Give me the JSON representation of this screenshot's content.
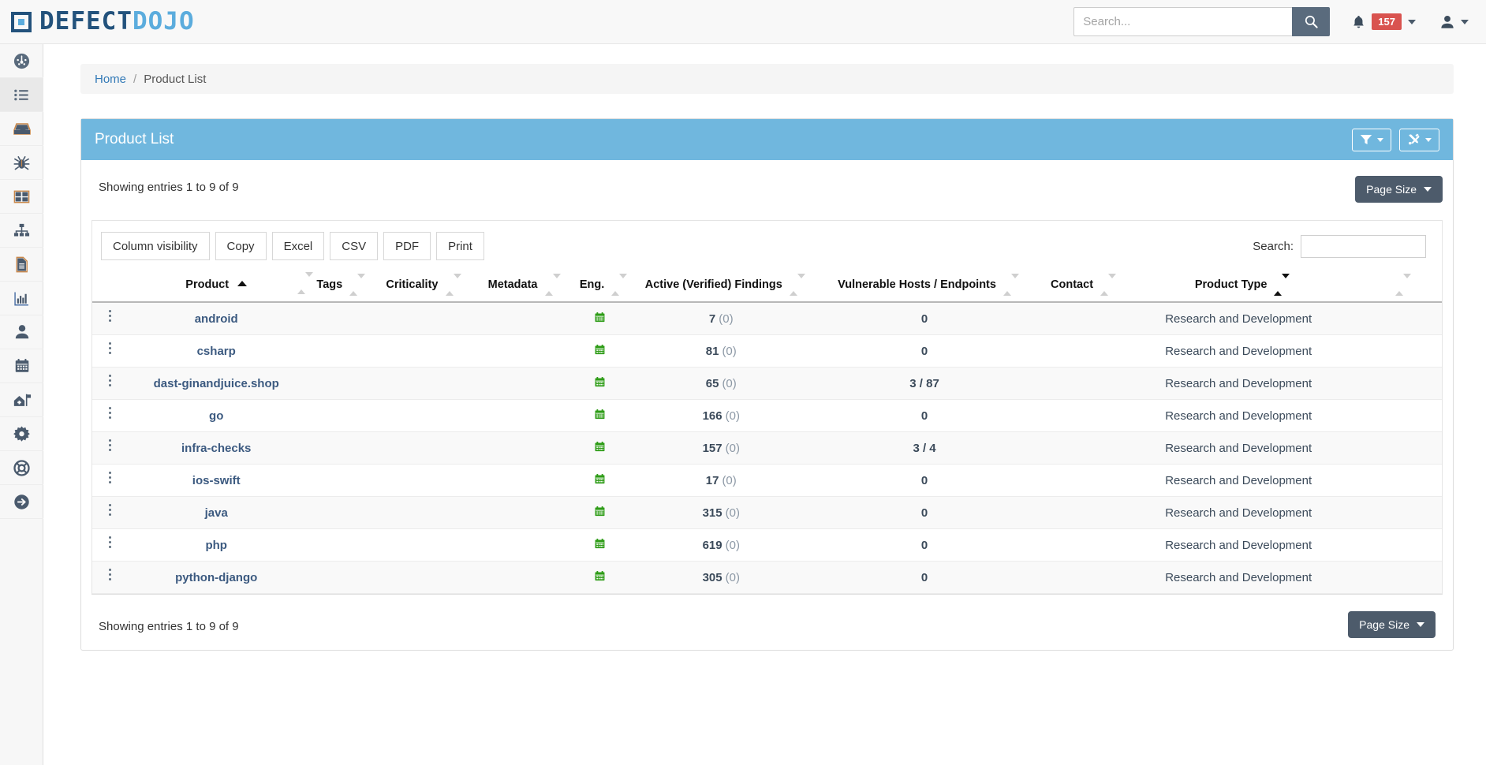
{
  "brand": {
    "part1": "DEFECT",
    "part2": "DOJO",
    "mark_icon": "logo-square-icon"
  },
  "navbar": {
    "search_placeholder": "Search...",
    "search_value": "",
    "search_icon": "search-icon",
    "bell_icon": "bell-icon",
    "notification_count": "157",
    "user_icon": "user-icon",
    "caret_icon": "caret-down-icon"
  },
  "sidebar": {
    "items": [
      {
        "name": "dashboard",
        "icon": "dashboard-speedometer-icon",
        "active": false
      },
      {
        "name": "product-list",
        "icon": "list-icon",
        "active": true
      },
      {
        "name": "inbox",
        "icon": "inbox-icon",
        "active": false
      },
      {
        "name": "findings",
        "icon": "bug-icon",
        "active": false
      },
      {
        "name": "endpoints",
        "icon": "table-grid-icon",
        "active": false
      },
      {
        "name": "hierarchy",
        "icon": "sitemap-icon",
        "active": false
      },
      {
        "name": "reports",
        "icon": "document-icon",
        "active": false
      },
      {
        "name": "metrics",
        "icon": "bar-chart-icon",
        "active": false
      },
      {
        "name": "users",
        "icon": "person-icon",
        "active": false
      },
      {
        "name": "calendar",
        "icon": "calendar-icon",
        "active": false
      },
      {
        "name": "benchmarks",
        "icon": "home-flag-icon",
        "active": false
      },
      {
        "name": "settings",
        "icon": "gear-icon",
        "active": false
      },
      {
        "name": "support",
        "icon": "lifebuoy-icon",
        "active": false
      },
      {
        "name": "logout",
        "icon": "arrow-circle-right-icon",
        "active": false
      }
    ]
  },
  "breadcrumb": {
    "home": "Home",
    "separator": "/",
    "current": "Product List"
  },
  "panel": {
    "title": "Product List",
    "filter_button": {
      "icon": "filter-funnel-icon",
      "caret": "caret-down-icon"
    },
    "tools_button": {
      "icon": "tools-wrench-icon",
      "caret": "caret-down-icon"
    }
  },
  "table_controls": {
    "showing_top": "Showing entries 1 to 9 of 9",
    "showing_bottom": "Showing entries 1 to 9 of 9",
    "page_size_top": "Page Size",
    "page_size_bottom": "Page Size",
    "export_buttons": [
      "Column visibility",
      "Copy",
      "Excel",
      "CSV",
      "PDF",
      "Print"
    ],
    "search_label": "Search:",
    "search_value": "",
    "search_placeholder": ""
  },
  "table": {
    "columns": [
      {
        "label": "Product",
        "sort": "asc"
      },
      {
        "label": "Tags",
        "sort": "none"
      },
      {
        "label": "Criticality",
        "sort": "none"
      },
      {
        "label": "Metadata",
        "sort": "none"
      },
      {
        "label": "Eng.",
        "sort": "none"
      },
      {
        "label": "Active (Verified) Findings",
        "sort": "none"
      },
      {
        "label": "Vulnerable Hosts / Endpoints",
        "sort": "none"
      },
      {
        "label": "Contact",
        "sort": "none"
      },
      {
        "label": "Product Type",
        "sort": "sortable"
      }
    ],
    "rows": [
      {
        "product": "android",
        "tags": "",
        "criticality": "",
        "metadata": "",
        "eng_icon": "calendar-green-icon",
        "findings": "7",
        "verified": "(0)",
        "vuln": "0",
        "contact": "",
        "product_type": "Research and Development"
      },
      {
        "product": "csharp",
        "tags": "",
        "criticality": "",
        "metadata": "",
        "eng_icon": "calendar-green-icon",
        "findings": "81",
        "verified": "(0)",
        "vuln": "0",
        "contact": "",
        "product_type": "Research and Development"
      },
      {
        "product": "dast-ginandjuice.shop",
        "tags": "",
        "criticality": "",
        "metadata": "",
        "eng_icon": "calendar-green-icon",
        "findings": "65",
        "verified": "(0)",
        "vuln": "3 / 87",
        "contact": "",
        "product_type": "Research and Development"
      },
      {
        "product": "go",
        "tags": "",
        "criticality": "",
        "metadata": "",
        "eng_icon": "calendar-green-icon",
        "findings": "166",
        "verified": "(0)",
        "vuln": "0",
        "contact": "",
        "product_type": "Research and Development"
      },
      {
        "product": "infra-checks",
        "tags": "",
        "criticality": "",
        "metadata": "",
        "eng_icon": "calendar-green-icon",
        "findings": "157",
        "verified": "(0)",
        "vuln": "3 / 4",
        "contact": "",
        "product_type": "Research and Development"
      },
      {
        "product": "ios-swift",
        "tags": "",
        "criticality": "",
        "metadata": "",
        "eng_icon": "calendar-green-icon",
        "findings": "17",
        "verified": "(0)",
        "vuln": "0",
        "contact": "",
        "product_type": "Research and Development"
      },
      {
        "product": "java",
        "tags": "",
        "criticality": "",
        "metadata": "",
        "eng_icon": "calendar-green-icon",
        "findings": "315",
        "verified": "(0)",
        "vuln": "0",
        "contact": "",
        "product_type": "Research and Development"
      },
      {
        "product": "php",
        "tags": "",
        "criticality": "",
        "metadata": "",
        "eng_icon": "calendar-green-icon",
        "findings": "619",
        "verified": "(0)",
        "vuln": "0",
        "contact": "",
        "product_type": "Research and Development"
      },
      {
        "product": "python-django",
        "tags": "",
        "criticality": "",
        "metadata": "",
        "eng_icon": "calendar-green-icon",
        "findings": "305",
        "verified": "(0)",
        "vuln": "0",
        "contact": "",
        "product_type": "Research and Development"
      }
    ]
  },
  "colors": {
    "brand_dark": "#23527c",
    "brand_light": "#5bacdd",
    "panel_header": "#70b7de",
    "badge_red": "#d9534f",
    "button_slate": "#4d5b6b",
    "link_blue": "#337ab7",
    "calendar_green": "#2e9c17"
  }
}
